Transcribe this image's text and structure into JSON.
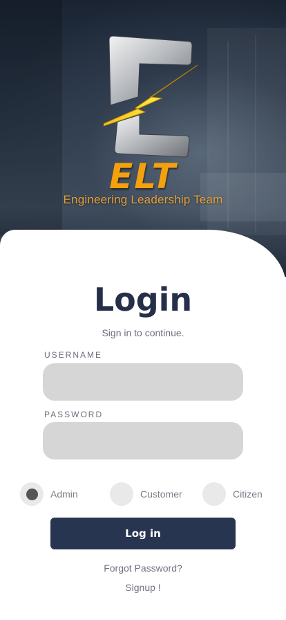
{
  "brand": {
    "name": "ELT",
    "tagline": "Engineering Leadership Team",
    "logo_icon": "elt-logo-lightning-e-icon",
    "accent_color": "#f5a00d"
  },
  "login": {
    "title": "Login",
    "subtitle": "Sign in to continue.",
    "username_label": "USERNAME",
    "username_value": "",
    "password_label": "PASSWORD",
    "password_value": ""
  },
  "roles": {
    "options": [
      "Admin",
      "Customer",
      "Citizen"
    ],
    "selected": "Admin"
  },
  "actions": {
    "login_label": "Log in",
    "forgot_label": "Forgot Password?",
    "signup_label": "Signup !"
  },
  "colors": {
    "primary": "#283551",
    "field_bg": "#d6d6d6"
  }
}
